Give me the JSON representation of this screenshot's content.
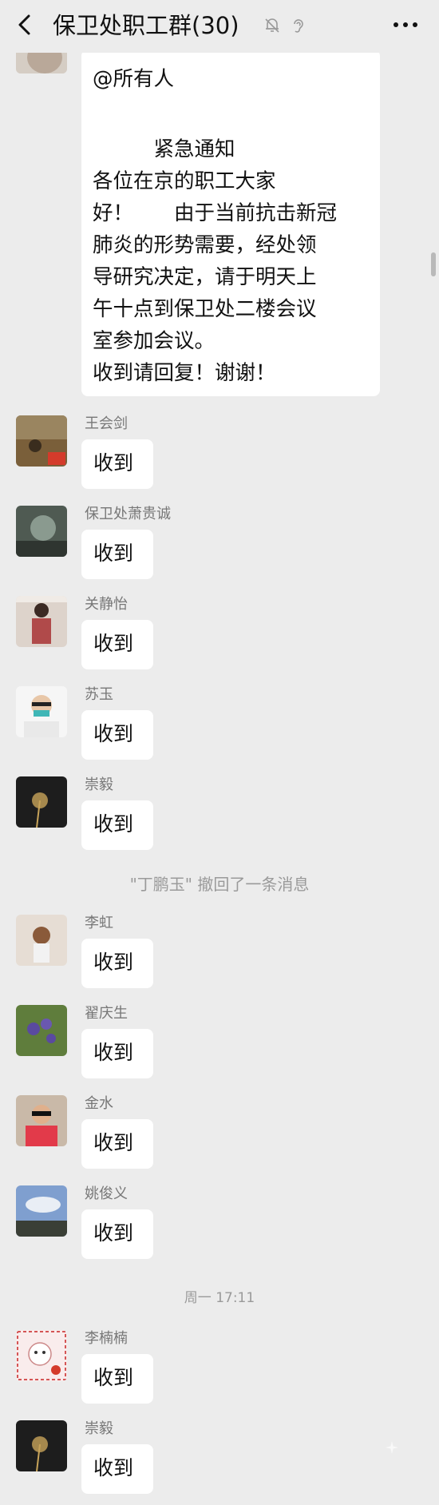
{
  "header": {
    "title": "保卫处职工群(30)",
    "back_icon": "back-arrow-icon",
    "mute_icon": "bell-muted-icon",
    "ear_icon": "ear-icon",
    "more_icon": "more-dots-icon"
  },
  "first_message": {
    "lines": [
      "@所有人",
      "",
      "　　　紧急通知",
      "各位在京的职工大家",
      "好！　　由于当前抗击新冠",
      "肺炎的形势需要，经处领",
      "导研究决定，请于明天上",
      "午十点到保卫处二楼会议",
      "室参加会议。",
      "收到请回复！谢谢！"
    ]
  },
  "messages_a": [
    {
      "name": "王会剑",
      "text": "收到",
      "avatar_color": "#6c5a38"
    },
    {
      "name": "保卫处萧贵诚",
      "text": "收到",
      "avatar_color": "#5e6b60"
    },
    {
      "name": "关静怡",
      "text": "收到",
      "avatar_color": "#c6b6ac"
    },
    {
      "name": "苏玉",
      "text": "收到",
      "avatar_color": "#f3f3f3"
    },
    {
      "name": "崇毅",
      "text": "收到",
      "avatar_color": "#222222"
    }
  ],
  "system_notice": "\"丁鹏玉\" 撤回了一条消息",
  "messages_b": [
    {
      "name": "李虹",
      "text": "收到",
      "avatar_color": "#e4d9cf"
    },
    {
      "name": "翟庆生",
      "text": "收到",
      "avatar_color": "#6a8a4a"
    },
    {
      "name": "金水",
      "text": "收到",
      "avatar_color": "#e55a5a"
    },
    {
      "name": "姚俊义",
      "text": "收到",
      "avatar_color": "#6f8ebd"
    }
  ],
  "timestamp": "周一 17:11",
  "messages_c": [
    {
      "name": "李楠楠",
      "text": "收到",
      "avatar_color": "#f7e3e3"
    },
    {
      "name": "崇毅",
      "text": "收到",
      "avatar_color": "#222222"
    }
  ]
}
